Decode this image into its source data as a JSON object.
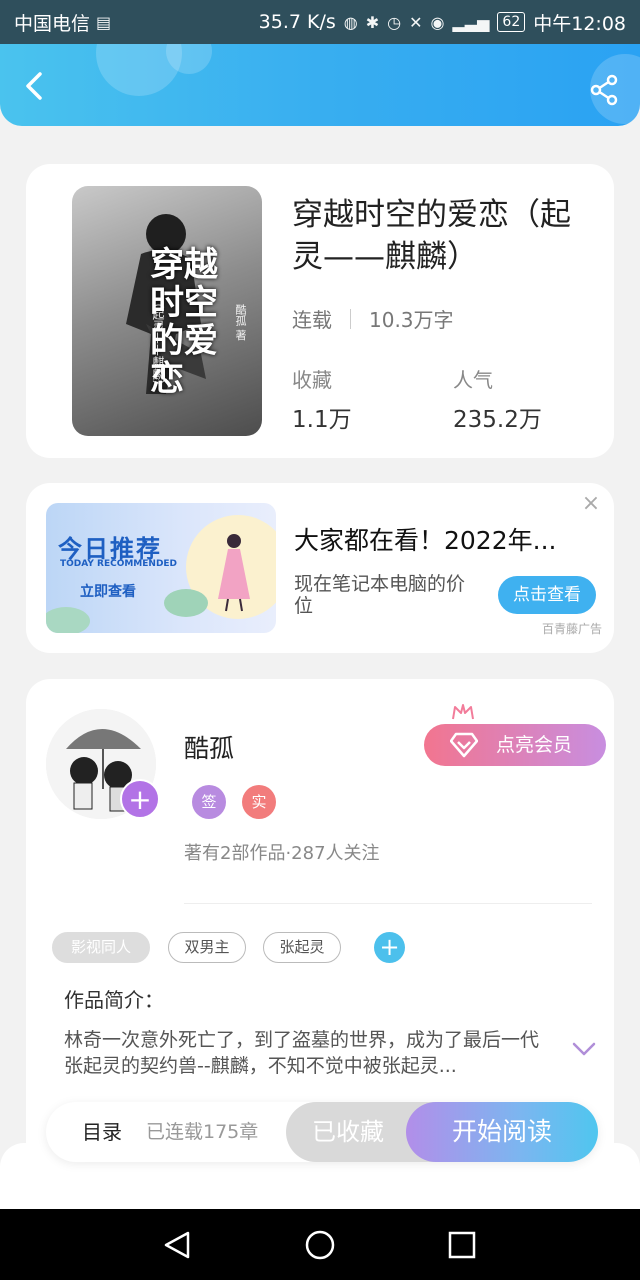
{
  "status_bar": {
    "carrier": "中国电信",
    "speed": "35.7 K/s",
    "battery": "62",
    "time": "中午12:08"
  },
  "header": {
    "back_icon": "chevron-left-icon",
    "share_icon": "share-icon"
  },
  "book": {
    "title": "穿越时空的爱恋（起灵——麒麟）",
    "cover_title": "穿越时空的爱恋",
    "cover_subtitle": "（起灵——麒麟）",
    "cover_author": "酷孤 著",
    "status": "连载",
    "word_count": "10.3万字",
    "favorites_label": "收藏",
    "favorites_value": "1.1万",
    "popularity_label": "人气",
    "popularity_value": "235.2万"
  },
  "ad": {
    "image_title": "今日推荐",
    "image_subtitle": "TODAY RECOMMENDED",
    "image_cta": "立即查看",
    "title": "大家都在看！2022年...",
    "description": "现在笔记本电脑的价位",
    "button": "点击查看",
    "source": "百青藤广告",
    "close_icon": "close-icon"
  },
  "author": {
    "name": "酷孤",
    "badges": [
      "签",
      "实"
    ],
    "badge_colors": [
      "#b88be0",
      "#f27c7c"
    ],
    "stats": "著有2部作品·287人关注",
    "vip_button": "点亮会员"
  },
  "tags": [
    {
      "label": "影视同人",
      "style": "solid"
    },
    {
      "label": "双男主",
      "style": "outline"
    },
    {
      "label": "张起灵",
      "style": "outline"
    }
  ],
  "intro": {
    "title": "作品简介：",
    "text": "林奇一次意外死亡了，到了盗墓的世界，成为了最后一代张起灵的契约兽--麒麟，不知不觉中被张起灵..."
  },
  "actions": {
    "toc": "目录",
    "chapter_count": "已连载175章",
    "collected": "已收藏",
    "start_reading": "开始阅读"
  },
  "colors": {
    "header_start": "#4ac3ee",
    "header_end": "#2aa2f3",
    "ad_button": "#3fb1f0",
    "vip_start": "#f2758f",
    "vip_end": "#c88ee0"
  }
}
